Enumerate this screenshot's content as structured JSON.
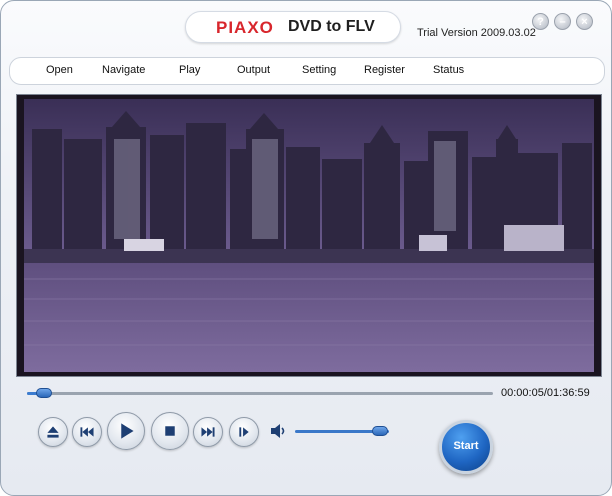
{
  "app": {
    "logo_text": "PIAXO",
    "title": "DVD to FLV",
    "version": "Trial Version 2009.03.02"
  },
  "window_buttons": [
    {
      "name": "help",
      "glyph": "?"
    },
    {
      "name": "minimize",
      "glyph": "–"
    },
    {
      "name": "close",
      "glyph": "×"
    }
  ],
  "menu": {
    "items": [
      "Open",
      "Navigate",
      "Play",
      "Output",
      "Setting",
      "Register",
      "Status"
    ]
  },
  "playback": {
    "time": "00:00:05/01:36:59",
    "progress_fraction": 0.02,
    "volume_fraction": 0.9
  },
  "controls": {
    "eject_icon": "eject-icon",
    "previous_icon": "skip-previous-icon",
    "play_icon": "play-icon",
    "stop_icon": "stop-icon",
    "next_icon": "skip-next-icon",
    "step_icon": "step-forward-icon",
    "volume_icon": "speaker-icon",
    "start_label": "Start"
  },
  "colors": {
    "accent": "#2b67b8",
    "logo_red": "#d8262c"
  }
}
